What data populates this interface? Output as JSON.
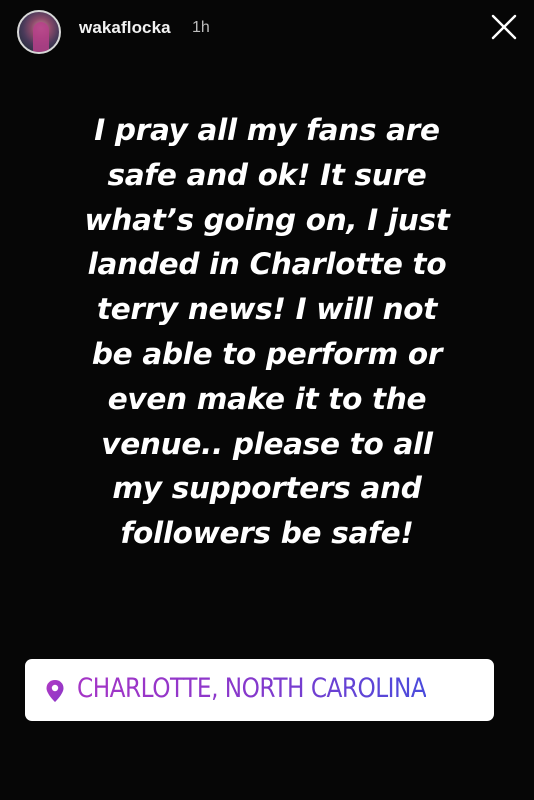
{
  "story": {
    "username": "wakaflocka",
    "timestamp": "1h",
    "message_lines": [
      "I pray all my fans are",
      "safe and ok!  It sure",
      "what’s going on, I just",
      "landed in Charlotte to",
      "terry news! I will not",
      "be able to perform or",
      "even make it to the",
      "venue.. please to all",
      "my supporters and",
      "followers be safe!"
    ],
    "location": "CHARLOTTE, NORTH CAROLINA"
  },
  "icons": {
    "close": "close-icon",
    "location": "location-pin-icon",
    "avatar": "avatar"
  },
  "colors": {
    "background": "#060606",
    "text": "#ffffff",
    "location_gradient_start": "#a535c6",
    "location_gradient_end": "#4a4bdc"
  }
}
